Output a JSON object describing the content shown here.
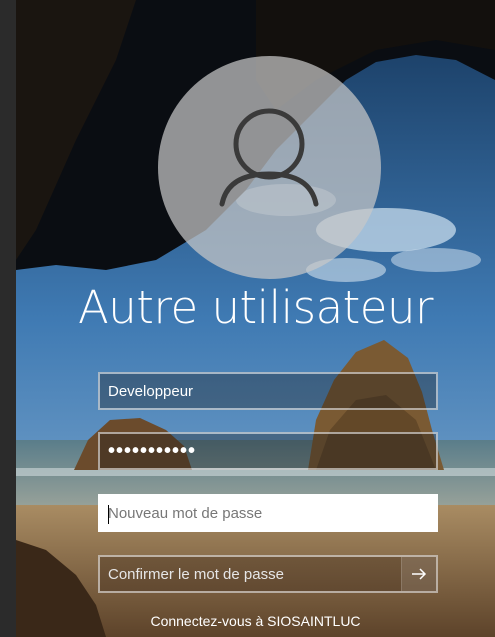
{
  "login": {
    "title": "Autre utilisateur",
    "username": "Developpeur",
    "password_mask": "•••••••••••",
    "new_password_placeholder": "Nouveau mot de passe",
    "confirm_password_placeholder": "Confirmer le mot de passe",
    "sign_in_to": "Connectez-vous à SIOSAINTLUC"
  },
  "icons": {
    "avatar": "user-silhouette-icon",
    "submit": "arrow-right-icon"
  }
}
